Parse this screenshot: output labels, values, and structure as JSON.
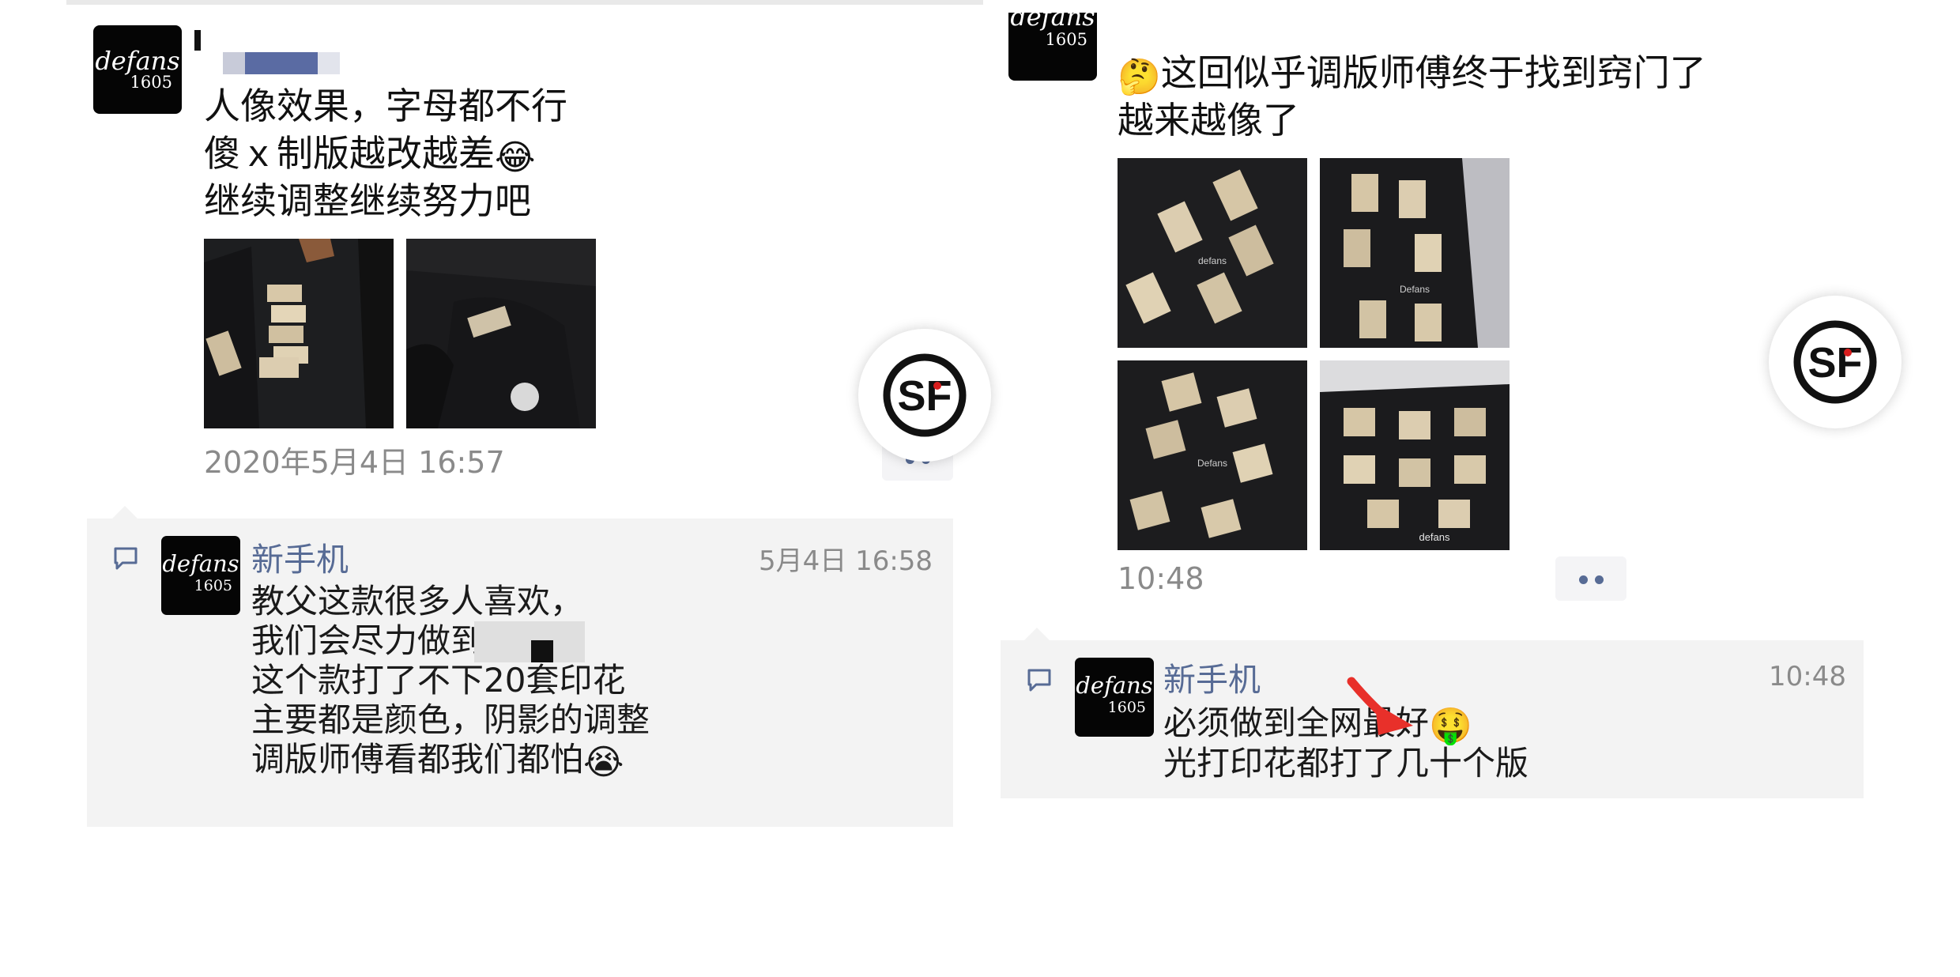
{
  "left_post": {
    "avatar_brand": "defans",
    "avatar_number": "1605",
    "text_lines": [
      "人像效果，字母都不行",
      "傻ｘ制版越改越差",
      "继续调整继续努力吧"
    ],
    "timestamp": "2020年5月4日 16:57",
    "comment": {
      "author": "新手机",
      "time": "5月4日 16:58",
      "lines": [
        "教父这款很多人喜欢，",
        "我们会尽力做到",
        "",
        "这个款打了不下20套印花",
        "主要都是颜色，阴影的调整",
        "调版师傅看都我们都怕"
      ]
    }
  },
  "right_post": {
    "avatar_brand": "defans",
    "avatar_number": "1605",
    "text_lines": [
      "这回似乎调版师傅终于找到窍门了",
      "越来越像了"
    ],
    "timestamp": "10:48",
    "image_captions": [
      "defans",
      "Defans",
      "Defans",
      "defans"
    ],
    "comment": {
      "author": "新手机",
      "time": "10:48",
      "lines": [
        "必须做到全网最好",
        "光打印花都打了几十个版"
      ]
    }
  },
  "icons": [
    "comment-icon",
    "more-options-icon",
    "sf-express-icon",
    "laughing-emoji",
    "crying-emoji",
    "thinking-emoji",
    "money-face-emoji"
  ],
  "colors": {
    "link": "#576b95",
    "comment_bg": "#f3f3f3",
    "timestamp": "#8a8a8a",
    "sf_red": "#d81e1e"
  }
}
